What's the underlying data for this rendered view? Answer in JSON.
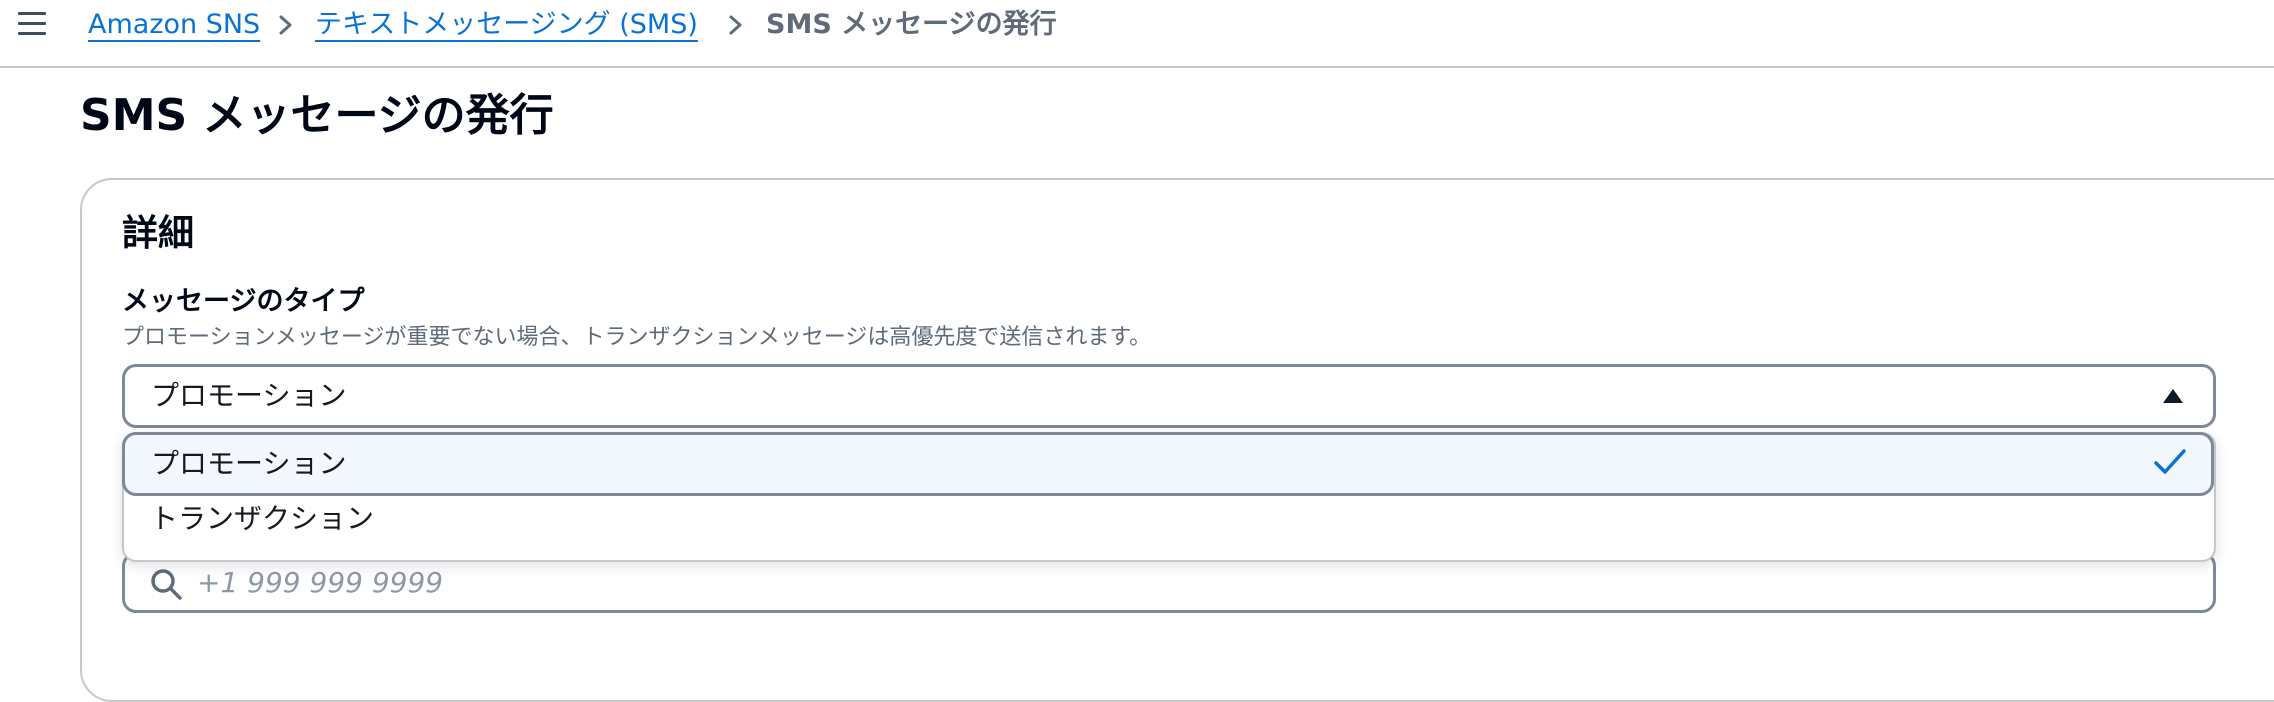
{
  "breadcrumb": {
    "items": [
      {
        "label": "Amazon SNS"
      },
      {
        "label": "テキストメッセージング (SMS)"
      },
      {
        "label": "SMS メッセージの発行"
      }
    ]
  },
  "page": {
    "title": "SMS メッセージの発行"
  },
  "details": {
    "title": "詳細",
    "message_type": {
      "label": "メッセージのタイプ",
      "description": "プロモーションメッセージが重要でない場合、トランザクションメッセージは高優先度で送信されます。",
      "selected_value": "プロモーション",
      "options": [
        {
          "label": "プロモーション",
          "selected": true
        },
        {
          "label": "トランザクション",
          "selected": false
        }
      ]
    },
    "phone_search": {
      "placeholder": "+1 999 999 9999"
    }
  },
  "icons": {
    "menu": "hamburger-menu-icon",
    "separator": "chevron-right-icon",
    "caret": "caret-up-icon",
    "check": "check-icon",
    "search": "search-icon"
  },
  "colors": {
    "link": "#0972d3",
    "text": "#16191f",
    "muted": "#5f6b7a",
    "border": "#7d8998",
    "selected_bg": "#f2f8fd",
    "check": "#0972d3",
    "caret": "#0f1b2a"
  }
}
